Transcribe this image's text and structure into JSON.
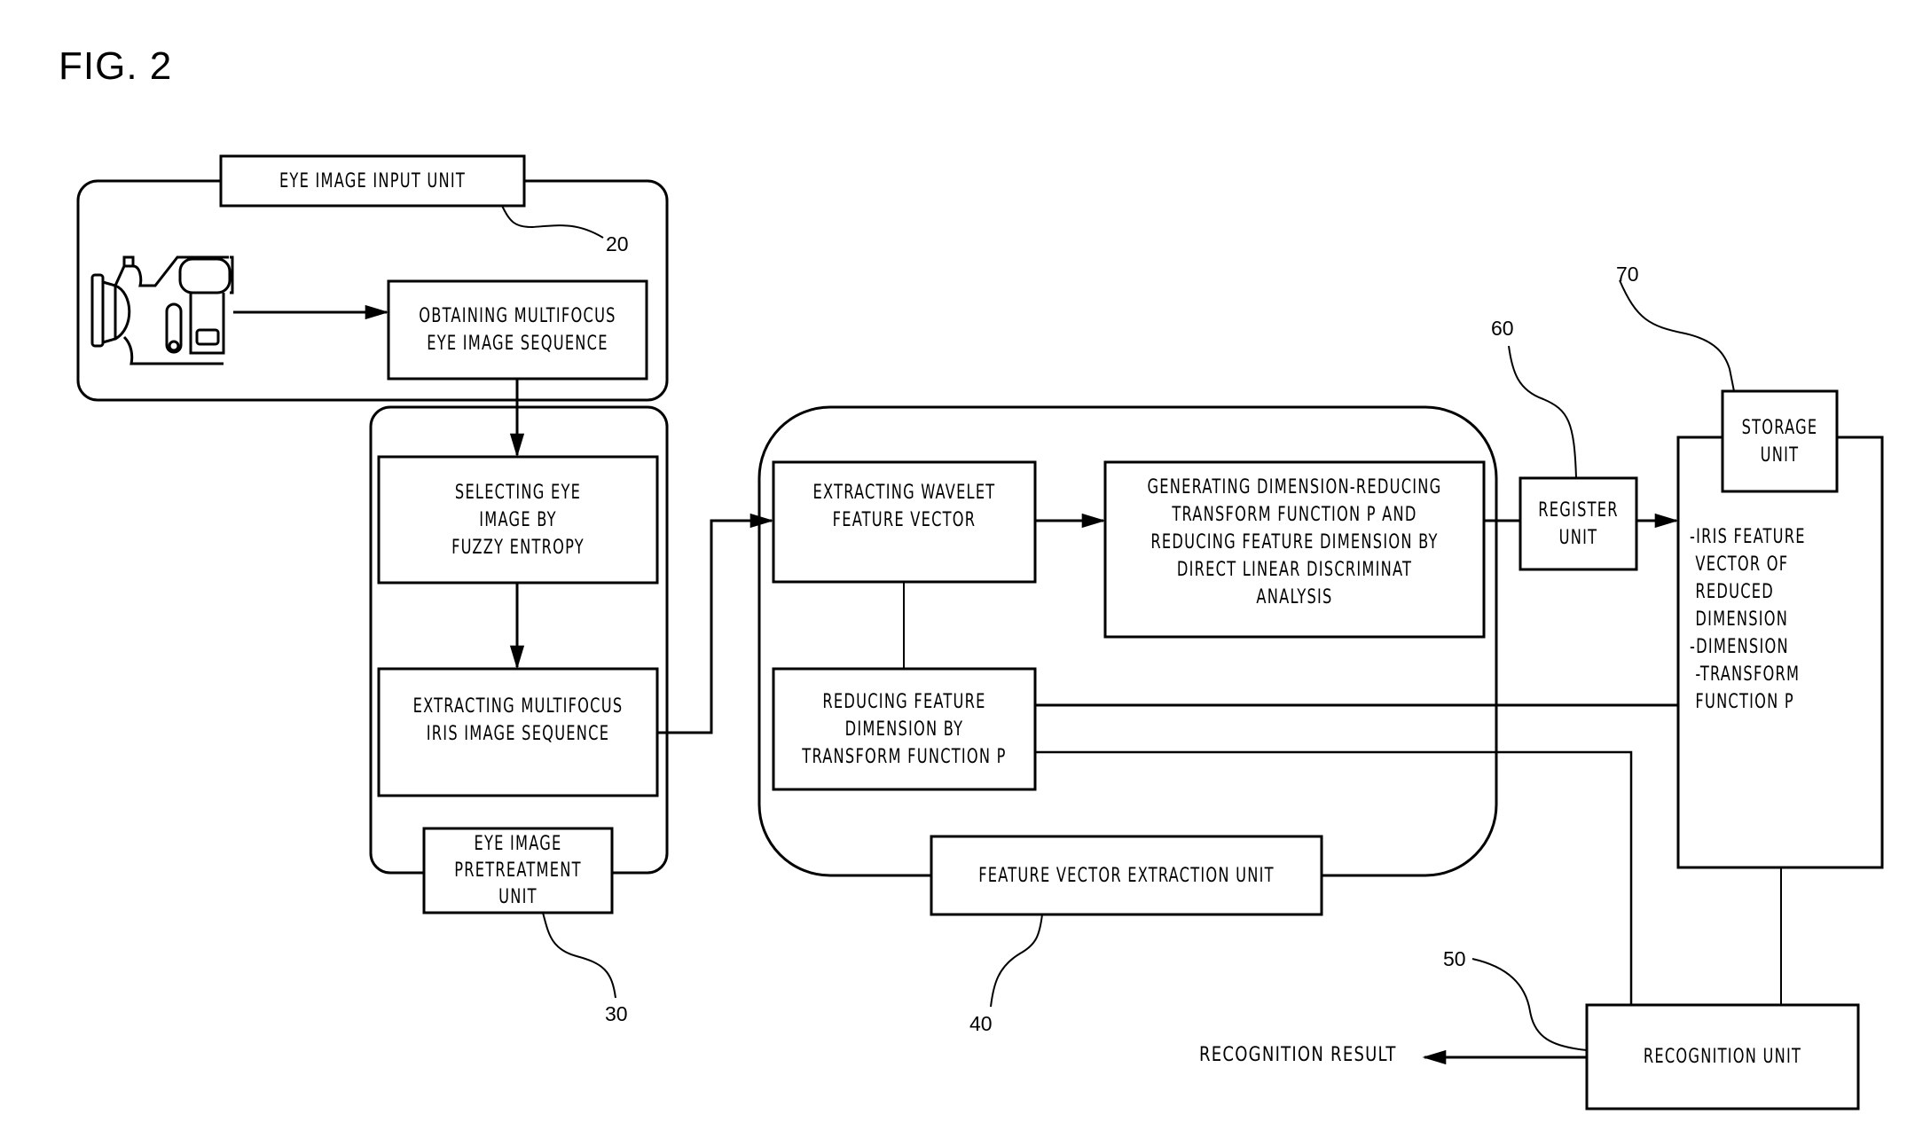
{
  "figure": {
    "title": "FIG. 2"
  },
  "units": {
    "eye_image_input": {
      "label": "EYE IMAGE INPUT UNIT",
      "ref": "20",
      "camera_icon": "video-camera-icon",
      "steps": [
        {
          "lines": [
            "OBTAINING MULTIFOCUS",
            "EYE IMAGE SEQUENCE"
          ]
        }
      ]
    },
    "eye_image_pretreatment": {
      "label_lines": [
        "EYE IMAGE",
        "PRETREATMENT",
        "UNIT"
      ],
      "ref": "30",
      "steps": [
        {
          "lines": [
            "SELECTING EYE",
            "IMAGE BY",
            "FUZZY ENTROPY"
          ]
        },
        {
          "lines": [
            "EXTRACTING MULTIFOCUS",
            "IRIS IMAGE SEQUENCE"
          ]
        }
      ]
    },
    "feature_vector_extraction": {
      "label": "FEATURE VECTOR EXTRACTION UNIT",
      "ref": "40",
      "steps": [
        {
          "lines": [
            "EXTRACTING WAVELET",
            "FEATURE VECTOR"
          ]
        },
        {
          "lines": [
            "GENERATING DIMENSION-REDUCING",
            "TRANSFORM FUNCTION P AND",
            "REDUCING FEATURE DIMENSION BY",
            "DIRECT LINEAR DISCRIMINAT",
            "ANALYSIS"
          ]
        },
        {
          "lines": [
            "REDUCING FEATURE",
            "DIMENSION BY",
            "TRANSFORM FUNCTION P"
          ]
        }
      ]
    },
    "register": {
      "label_lines": [
        "REGISTER",
        "UNIT"
      ],
      "ref": "60"
    },
    "storage": {
      "label_lines": [
        "STORAGE",
        "UNIT"
      ],
      "ref": "70",
      "contents": [
        "-IRIS FEATURE",
        " VECTOR OF",
        " REDUCED",
        " DIMENSION",
        "-DIMENSION",
        " -TRANSFORM",
        " FUNCTION P"
      ]
    },
    "recognition": {
      "label": "RECOGNITION UNIT",
      "ref": "50",
      "output": "RECOGNITION RESULT"
    }
  }
}
